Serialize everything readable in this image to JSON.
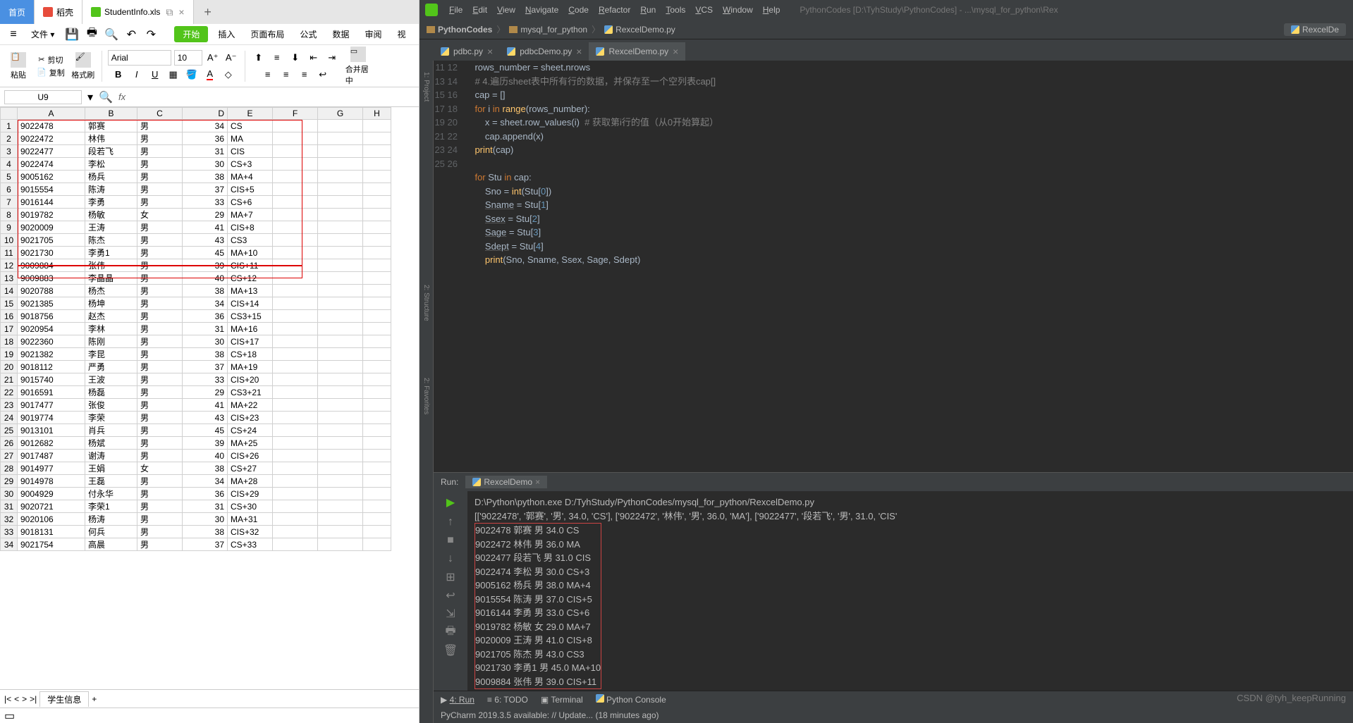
{
  "wps": {
    "tabs": {
      "home": "首页",
      "dk": "稻壳",
      "file": "StudentInfo.xls",
      "add": "+"
    },
    "menu": {
      "file": "文件",
      "start": "开始",
      "insert": "插入",
      "page": "页面布局",
      "formula": "公式",
      "data": "数据",
      "review": "审阅",
      "view": "视"
    },
    "ribbon": {
      "paste": "粘贴",
      "cut": "剪切",
      "copy": "复制",
      "format": "格式刷",
      "font": "Arial",
      "size": "10",
      "merge": "合并居中"
    },
    "namebox": "U9",
    "fx": "fx",
    "cols": [
      "A",
      "B",
      "C",
      "D",
      "E",
      "F",
      "G",
      "H"
    ],
    "rows": [
      [
        "9022478",
        "郭赛",
        "男",
        "34",
        "CS",
        "",
        "",
        ""
      ],
      [
        "9022472",
        "林伟",
        "男",
        "36",
        "MA",
        "",
        "",
        ""
      ],
      [
        "9022477",
        "段若飞",
        "男",
        "31",
        "CIS",
        "",
        "",
        ""
      ],
      [
        "9022474",
        "李松",
        "男",
        "30",
        "CS+3",
        "",
        "",
        ""
      ],
      [
        "9005162",
        "杨兵",
        "男",
        "38",
        "MA+4",
        "",
        "",
        ""
      ],
      [
        "9015554",
        "陈涛",
        "男",
        "37",
        "CIS+5",
        "",
        "",
        ""
      ],
      [
        "9016144",
        "李勇",
        "男",
        "33",
        "CS+6",
        "",
        "",
        ""
      ],
      [
        "9019782",
        "杨敏",
        "女",
        "29",
        "MA+7",
        "",
        "",
        ""
      ],
      [
        "9020009",
        "王涛",
        "男",
        "41",
        "CIS+8",
        "",
        "",
        ""
      ],
      [
        "9021705",
        "陈杰",
        "男",
        "43",
        "CS3",
        "",
        "",
        ""
      ],
      [
        "9021730",
        "李勇1",
        "男",
        "45",
        "MA+10",
        "",
        "",
        ""
      ],
      [
        "9009884",
        "张伟",
        "男",
        "39",
        "CIS+11",
        "",
        "",
        ""
      ],
      [
        "9009883",
        "李晶晶",
        "男",
        "40",
        "CS+12",
        "",
        "",
        ""
      ],
      [
        "9020788",
        "杨杰",
        "男",
        "38",
        "MA+13",
        "",
        "",
        ""
      ],
      [
        "9021385",
        "杨坤",
        "男",
        "34",
        "CIS+14",
        "",
        "",
        ""
      ],
      [
        "9018756",
        "赵杰",
        "男",
        "36",
        "CS3+15",
        "",
        "",
        ""
      ],
      [
        "9020954",
        "李林",
        "男",
        "31",
        "MA+16",
        "",
        "",
        ""
      ],
      [
        "9022360",
        "陈刚",
        "男",
        "30",
        "CIS+17",
        "",
        "",
        ""
      ],
      [
        "9021382",
        "李昆",
        "男",
        "38",
        "CS+18",
        "",
        "",
        ""
      ],
      [
        "9018112",
        "严勇",
        "男",
        "37",
        "MA+19",
        "",
        "",
        ""
      ],
      [
        "9015740",
        "王波",
        "男",
        "33",
        "CIS+20",
        "",
        "",
        ""
      ],
      [
        "9016591",
        "杨磊",
        "男",
        "29",
        "CS3+21",
        "",
        "",
        ""
      ],
      [
        "9017477",
        "张俊",
        "男",
        "41",
        "MA+22",
        "",
        "",
        ""
      ],
      [
        "9019774",
        "李荣",
        "男",
        "43",
        "CIS+23",
        "",
        "",
        ""
      ],
      [
        "9013101",
        "肖兵",
        "男",
        "45",
        "CS+24",
        "",
        "",
        ""
      ],
      [
        "9012682",
        "杨斌",
        "男",
        "39",
        "MA+25",
        "",
        "",
        ""
      ],
      [
        "9017487",
        "谢涛",
        "男",
        "40",
        "CIS+26",
        "",
        "",
        ""
      ],
      [
        "9014977",
        "王娟",
        "女",
        "38",
        "CS+27",
        "",
        "",
        ""
      ],
      [
        "9014978",
        "王磊",
        "男",
        "34",
        "MA+28",
        "",
        "",
        ""
      ],
      [
        "9004929",
        "付永华",
        "男",
        "36",
        "CIS+29",
        "",
        "",
        ""
      ],
      [
        "9020721",
        "李荣1",
        "男",
        "31",
        "CS+30",
        "",
        "",
        ""
      ],
      [
        "9020106",
        "杨涛",
        "男",
        "30",
        "MA+31",
        "",
        "",
        ""
      ],
      [
        "9018131",
        "何兵",
        "男",
        "38",
        "CIS+32",
        "",
        "",
        ""
      ],
      [
        "9021754",
        "高晨",
        "男",
        "37",
        "CS+33",
        "",
        "",
        ""
      ]
    ],
    "sheet_tab": "学生信息"
  },
  "pycharm": {
    "menu": [
      "File",
      "Edit",
      "View",
      "Navigate",
      "Code",
      "Refactor",
      "Run",
      "Tools",
      "VCS",
      "Window",
      "Help"
    ],
    "title": "PythonCodes [D:\\TyhStudy\\PythonCodes] - ...\\mysql_for_python\\Rex",
    "breadcrumb": {
      "p1": "PythonCodes",
      "p2": "mysql_for_python",
      "p3": "RexcelDemo.py"
    },
    "run_config": "RexcelDe",
    "editor_tabs": {
      "t1": "pdbc.py",
      "t2": "pdbcDemo.py",
      "t3": "RexcelDemo.py"
    },
    "side_label": "1: Project",
    "side_label2": "2: Structure",
    "side_label3": "2: Favorites",
    "code_start_line": 11,
    "code_lines": [
      {
        "indent": 1,
        "html": "rows_number = sheet.nrows"
      },
      {
        "indent": 1,
        "html": "<span class='cmt'># 4.遍历sheet表中所有行的数据，并保存至一个空列表cap[]</span>"
      },
      {
        "indent": 1,
        "html": "cap = []"
      },
      {
        "indent": 1,
        "html": "<span class='kw'>for</span> i <span class='kw'>in</span> <span class='fn'>range</span>(rows_number):"
      },
      {
        "indent": 2,
        "html": "x = sheet.row_values(i)  <span class='cmt'># 获取第i行的值（从0开始算起）</span>"
      },
      {
        "indent": 2,
        "html": "cap.append(x)"
      },
      {
        "indent": 1,
        "html": "<span class='fn'>print</span>(cap)"
      },
      {
        "indent": 0,
        "html": ""
      },
      {
        "indent": 1,
        "html": "<span class='kw'>for</span> Stu <span class='kw'>in</span> cap:"
      },
      {
        "indent": 2,
        "html": "Sno = <span class='fn'>int</span>(Stu[<span class='num'>0</span>])"
      },
      {
        "indent": 2,
        "html": "<span class='ul'>Sname</span> = Stu[<span class='num'>1</span>]"
      },
      {
        "indent": 2,
        "html": "<span class='ul'>Ssex</span> = Stu[<span class='num'>2</span>]"
      },
      {
        "indent": 2,
        "html": "<span class='ul'>Sage</span> = Stu[<span class='num'>3</span>]"
      },
      {
        "indent": 2,
        "html": "<span class='ul'>Sdept</span> = Stu[<span class='num'>4</span>]"
      },
      {
        "indent": 2,
        "html": "<span class='fn'>print</span>(Sno, Sname, Ssex, Sage, Sdept)"
      },
      {
        "indent": 0,
        "html": ""
      }
    ],
    "run_label": "Run:",
    "run_tab": "RexcelDemo",
    "run_cmd": "D:\\Python\\python.exe D:/TyhStudy/PythonCodes/mysql_for_python/RexcelDemo.py",
    "run_list_line": "[['9022478', '郭赛', '男', 34.0, 'CS'], ['9022472', '林伟', '男', 36.0, 'MA'], ['9022477', '段若飞', '男', 31.0, 'CIS'",
    "run_out_lines": [
      "9022478 郭赛 男 34.0 CS",
      "9022472 林伟 男 36.0 MA",
      "9022477 段若飞 男 31.0 CIS",
      "9022474 李松 男 30.0 CS+3",
      "9005162 杨兵 男 38.0 MA+4",
      "9015554 陈涛 男 37.0 CIS+5",
      "9016144 李勇 男 33.0 CS+6",
      "9019782 杨敏 女 29.0 MA+7",
      "9020009 王涛 男 41.0 CIS+8",
      "9021705 陈杰 男 43.0 CS3",
      "9021730 李勇1 男 45.0 MA+10",
      "9009884 张伟 男 39.0 CIS+11"
    ],
    "bottom_tabs": {
      "run": "4: Run",
      "todo": "6: TODO",
      "term": "Terminal",
      "pyc": "Python Console"
    },
    "status": "PyCharm 2019.3.5 available: // Update... (18 minutes ago)",
    "watermark": "CSDN @tyh_keepRunning"
  }
}
